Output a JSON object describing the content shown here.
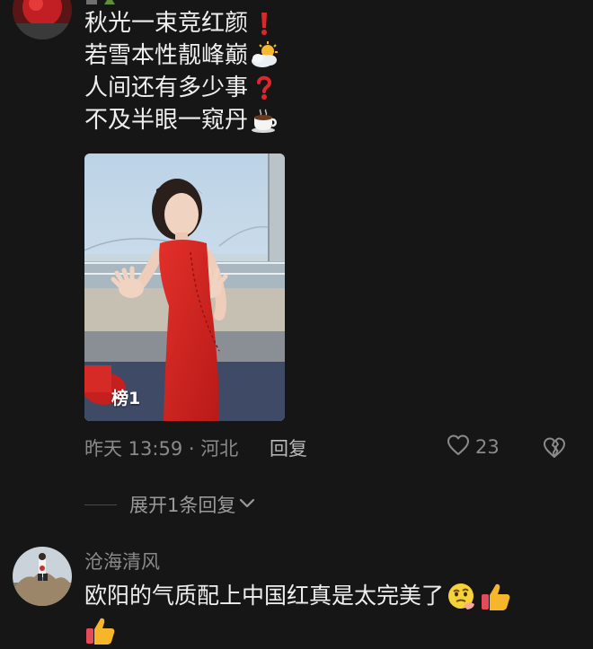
{
  "comment_top": {
    "poem_lines": [
      {
        "text": "秋光一束竞红颜",
        "emoji": "red-exclamation-icon"
      },
      {
        "text": "若雪本性靓峰巅",
        "emoji": "sun-behind-cloud-icon"
      },
      {
        "text": "人间还有多少事",
        "emoji": "red-question-icon"
      },
      {
        "text": "不及半眼一窥丹",
        "emoji": "coffee-cup-icon"
      }
    ],
    "photo_tag": "榜1",
    "timestamp_location": "昨天 13:59 · 河北",
    "reply_label": "回复",
    "like_count": "23",
    "expand_replies_label": "展开1条回复"
  },
  "comment_second": {
    "username": "沧海清风",
    "text": "欧阳的气质配上中国红真是太完美了",
    "emojis": [
      "thinking-face-icon",
      "thumbs-up-icon",
      "thumbs-up-icon"
    ]
  },
  "colors": {
    "background": "#161616",
    "text_primary": "#efefef",
    "text_secondary": "#8a8a8a",
    "dress_red": "#d8231f"
  }
}
